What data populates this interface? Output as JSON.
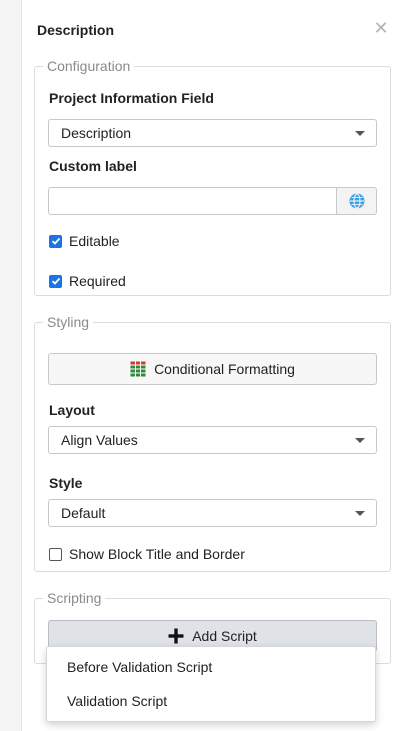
{
  "panel": {
    "title": "Description"
  },
  "configuration": {
    "legend": "Configuration",
    "project_field_label": "Project Information Field",
    "project_field_value": "Description",
    "custom_label_label": "Custom label",
    "custom_label_value": "",
    "editable_label": "Editable",
    "editable_checked": true,
    "required_label": "Required",
    "required_checked": true
  },
  "styling": {
    "legend": "Styling",
    "conditional_formatting_label": "Conditional Formatting",
    "layout_label": "Layout",
    "layout_value": "Align Values",
    "style_label": "Style",
    "style_value": "Default",
    "show_title_label": "Show Block Title and Border",
    "show_title_checked": false
  },
  "scripting": {
    "legend": "Scripting",
    "add_script_label": "Add Script",
    "menu_items": [
      "Before Validation Script",
      "Validation Script"
    ]
  },
  "colors": {
    "accent": "#1a73e8",
    "globe": "#3aa0e6",
    "grid_green": "#2e8b3d",
    "grid_red": "#d33b2c"
  }
}
